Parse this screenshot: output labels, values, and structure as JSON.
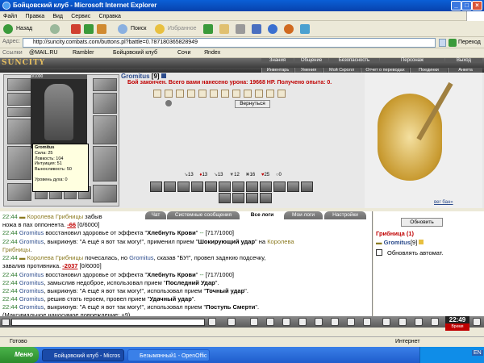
{
  "window": {
    "title": "Бойцовский клуб - Microsoft Internet Explorer"
  },
  "menu": [
    "Файл",
    "Правка",
    "Вид",
    "Сервис",
    "Справка"
  ],
  "toolbar": {
    "back": "Назад",
    "search": "Поиск",
    "favorites": "Избранное"
  },
  "address": {
    "label": "Адрес:",
    "url": "http://suncity.combats.com/buttons.pl?battle=0.787180365828949",
    "go": "Переход"
  },
  "links": {
    "label": "Ссылки",
    "items": [
      "@MAIL.RU",
      "Rambler",
      "Бойцовский клуб",
      "Сочи",
      "Яndex"
    ]
  },
  "game": {
    "logo": "SUNCITY",
    "top_nav": [
      "Знания",
      "Общение",
      "Безопасность",
      "Персонаж",
      "Выход"
    ],
    "sub_nav": [
      "Инвентарь",
      "Умения",
      "Мой Скролл",
      "Отчет о переводах",
      "Поединки",
      "Анкета"
    ],
    "character": {
      "name": "Gromitus",
      "level": "[9]",
      "hp": "0/1000"
    },
    "stats_title": "Gromitus",
    "stats": [
      "Сила: 25",
      "Ловкость: 104",
      "Интуиция: 51",
      "Выносливость: 50",
      "",
      "Уровень духа: 0"
    ],
    "battle_message": "Бой закончен. Всего вами нанесено урона: 19668 HP. Получено опыта: 0.",
    "return_button": "Вернуться",
    "counters": [
      "13",
      "13",
      "13",
      "12",
      "16",
      "25",
      "0"
    ],
    "treasure_caption": "вег бан»"
  },
  "chat": {
    "tabs": [
      "Чат",
      "Системные сообщения",
      "Все логи",
      "Мои логи",
      "Настройки"
    ],
    "active_tab": "Все логи",
    "lines": [
      [
        {
          "c": "time",
          "t": "22:44 "
        },
        {
          "c": "nmr",
          "t": "▬ Королева Грибницы"
        },
        {
          "c": "",
          "t": " забыв"
        }
      ],
      [
        {
          "c": "",
          "t": "ножа в пах оппонента. "
        },
        {
          "c": "red",
          "t": "-66"
        },
        {
          "c": "",
          "t": " [0/6000]"
        }
      ],
      [
        {
          "c": "time",
          "t": "22:44 "
        },
        {
          "c": "nm",
          "t": "Gromitus"
        },
        {
          "c": "",
          "t": " восстановил здоровье от эффекта \""
        },
        {
          "c": "b",
          "t": "Хлебнуть Крови"
        },
        {
          "c": "",
          "t": "\" "
        },
        {
          "c": "grn",
          "t": "--"
        },
        {
          "c": "",
          "t": " [717/1000]"
        }
      ],
      [
        {
          "c": "time",
          "t": "22:44 "
        },
        {
          "c": "nm",
          "t": "Gromitus"
        },
        {
          "c": "",
          "t": ", выкрикнув: \"А ещё я вот так могу!\", применил прием \""
        },
        {
          "c": "b",
          "t": "Шокирующий удар"
        },
        {
          "c": "",
          "t": "\" на "
        },
        {
          "c": "nmr",
          "t": "Королева"
        }
      ],
      [
        {
          "c": "nmr",
          "t": "Грибницы"
        },
        {
          "c": "",
          "t": "."
        }
      ],
      [
        {
          "c": "time",
          "t": "22:44 "
        },
        {
          "c": "nmr",
          "t": "▬ Королева Грибницы"
        },
        {
          "c": "",
          "t": " почесалась, но "
        },
        {
          "c": "nm",
          "t": "Gromitus"
        },
        {
          "c": "",
          "t": ", сказав \"БУ!\", провел заднюю подсечку,"
        }
      ],
      [
        {
          "c": "",
          "t": "завалив противника. "
        },
        {
          "c": "red",
          "t": "-2037"
        },
        {
          "c": "",
          "t": " [0/6000]"
        }
      ],
      [
        {
          "c": "time",
          "t": "22:44 "
        },
        {
          "c": "nm",
          "t": "Gromitus"
        },
        {
          "c": "",
          "t": " восстановил здоровье от эффекта \""
        },
        {
          "c": "b",
          "t": "Хлебнуть Крови"
        },
        {
          "c": "",
          "t": "\" "
        },
        {
          "c": "grn",
          "t": "--"
        },
        {
          "c": "",
          "t": " [717/1000]"
        }
      ],
      [
        {
          "c": "time",
          "t": "22:44 "
        },
        {
          "c": "nm",
          "t": "Gromitus"
        },
        {
          "c": "",
          "t": ", замыслив недоброе, использовал прием \""
        },
        {
          "c": "b",
          "t": "Последний Удар"
        },
        {
          "c": "",
          "t": "\"."
        }
      ],
      [
        {
          "c": "time",
          "t": "22:44 "
        },
        {
          "c": "nm",
          "t": "Gromitus"
        },
        {
          "c": "",
          "t": ", выкрикнув: \"А ещё я вот так могу!\", использовал прием \""
        },
        {
          "c": "b",
          "t": "Точный удар"
        },
        {
          "c": "",
          "t": "\"."
        }
      ],
      [
        {
          "c": "time",
          "t": "22:44 "
        },
        {
          "c": "nm",
          "t": "Gromitus"
        },
        {
          "c": "",
          "t": ", решив стать героем, провел прием \""
        },
        {
          "c": "b",
          "t": "Удачный удар"
        },
        {
          "c": "",
          "t": "\"."
        }
      ],
      [
        {
          "c": "time",
          "t": "22:44 "
        },
        {
          "c": "nm",
          "t": "Gromitus"
        },
        {
          "c": "",
          "t": ", выкрикнув: \"А ещё я вот так могу!\", использовал прием \""
        },
        {
          "c": "b",
          "t": "Поступь Смерти"
        },
        {
          "c": "",
          "t": "\"."
        }
      ],
      [
        {
          "c": "",
          "t": "(Максимальное наносимое повреждение: +9)"
        }
      ]
    ]
  },
  "side": {
    "refresh": "Обновить",
    "location": "Грибница (1)",
    "player": "Gromitus",
    "player_level": "[9]",
    "auto": "Обновлять автомат."
  },
  "clock": {
    "time": "22:49",
    "label": "Время"
  },
  "status": {
    "left": "Готово",
    "right": "Интернет"
  },
  "taskbar": {
    "start": "Меню",
    "tasks": [
      "Бойцовский клуб - Micros",
      "Безымянный1 - OpenOffic"
    ],
    "lang": "EN"
  }
}
